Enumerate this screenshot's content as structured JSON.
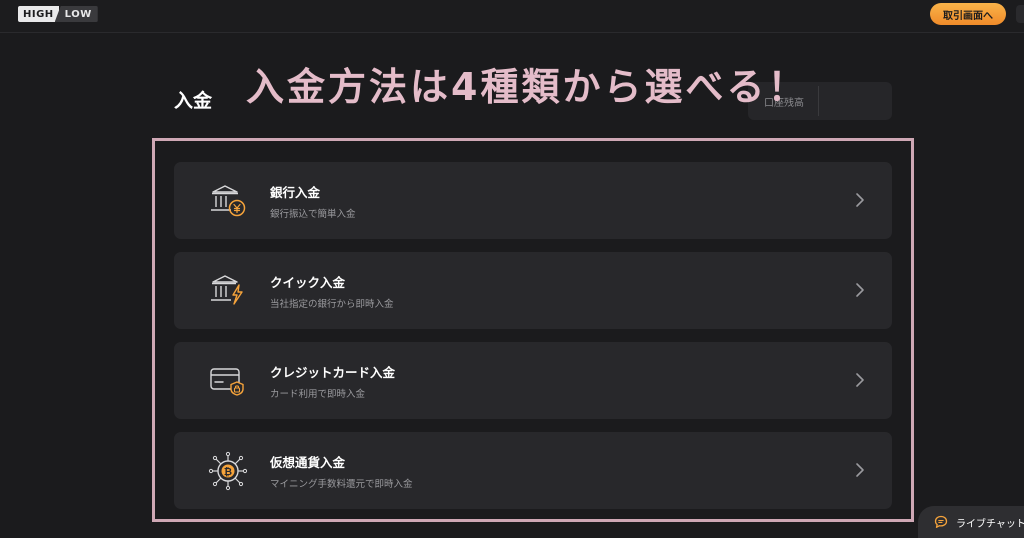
{
  "header": {
    "logo": {
      "high": "HIGH",
      "low": "LOW"
    },
    "trade_button_label": "取引画面へ"
  },
  "page": {
    "title": "入金",
    "balance_label": "口座残高",
    "overlay_caption": "入金方法は4種類から選べる！"
  },
  "methods": [
    {
      "icon": "bank-yen-icon",
      "title": "銀行入金",
      "description": "銀行振込で簡単入金"
    },
    {
      "icon": "bank-lightning-icon",
      "title": "クイック入金",
      "description": "当社指定の銀行から即時入金"
    },
    {
      "icon": "credit-card-lock-icon",
      "title": "クレジットカード入金",
      "description": "カード利用で即時入金"
    },
    {
      "icon": "bitcoin-icon",
      "title": "仮想通貨入金",
      "description": "マイニング手数料還元で即時入金"
    }
  ],
  "live_chat": {
    "label": "ライブチャット"
  },
  "colors": {
    "background": "#1b1b1d",
    "card": "#28282b",
    "accent_orange": "#f5a33b",
    "caption_pink": "#e4bcc9",
    "frame_pink": "#cfa8b5"
  }
}
